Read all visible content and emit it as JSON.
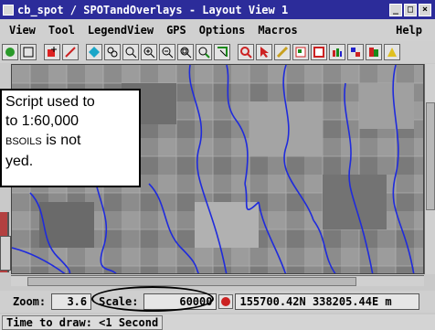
{
  "window": {
    "title": "cb_spot / SPOTandOverlays - Layout View 1",
    "controls": [
      "minimize",
      "maximize",
      "close"
    ]
  },
  "menu": {
    "items": [
      "View",
      "Tool",
      "LegendView",
      "GPS",
      "Options",
      "Macros"
    ],
    "help": "Help"
  },
  "toolbar": {
    "icons": [
      "layout-icon",
      "frame-icon",
      "add-layer-icon",
      "edit-icon",
      "select-icon",
      "pan-icon",
      "zoom-box-icon",
      "zoom-in-icon",
      "zoom-out-icon",
      "zoom-full-icon",
      "zoom-group-icon",
      "measure-icon",
      "query-icon",
      "pointer-icon",
      "draw-icon",
      "legend-icon",
      "display-icon",
      "settings-icon",
      "gps-icon",
      "macro-icon",
      "redraw-icon"
    ]
  },
  "callout": {
    "line1": "Script used to",
    "line2": "to 1:60,000",
    "line3_small": "BSOILS",
    "line3_rest": " is not",
    "line4": "yed."
  },
  "status": {
    "zoom_label": "Zoom:",
    "zoom_value": "3.6",
    "scale_label": "Scale:",
    "scale_value": "60000",
    "coordinates": "155700.42N  338205.44E  m",
    "time_to_draw": "Time to draw: <1 Second"
  },
  "colors": {
    "titlebar": "#2c2c9a",
    "stream": "#1f2bdc",
    "map_base": "#8c8c8c"
  }
}
